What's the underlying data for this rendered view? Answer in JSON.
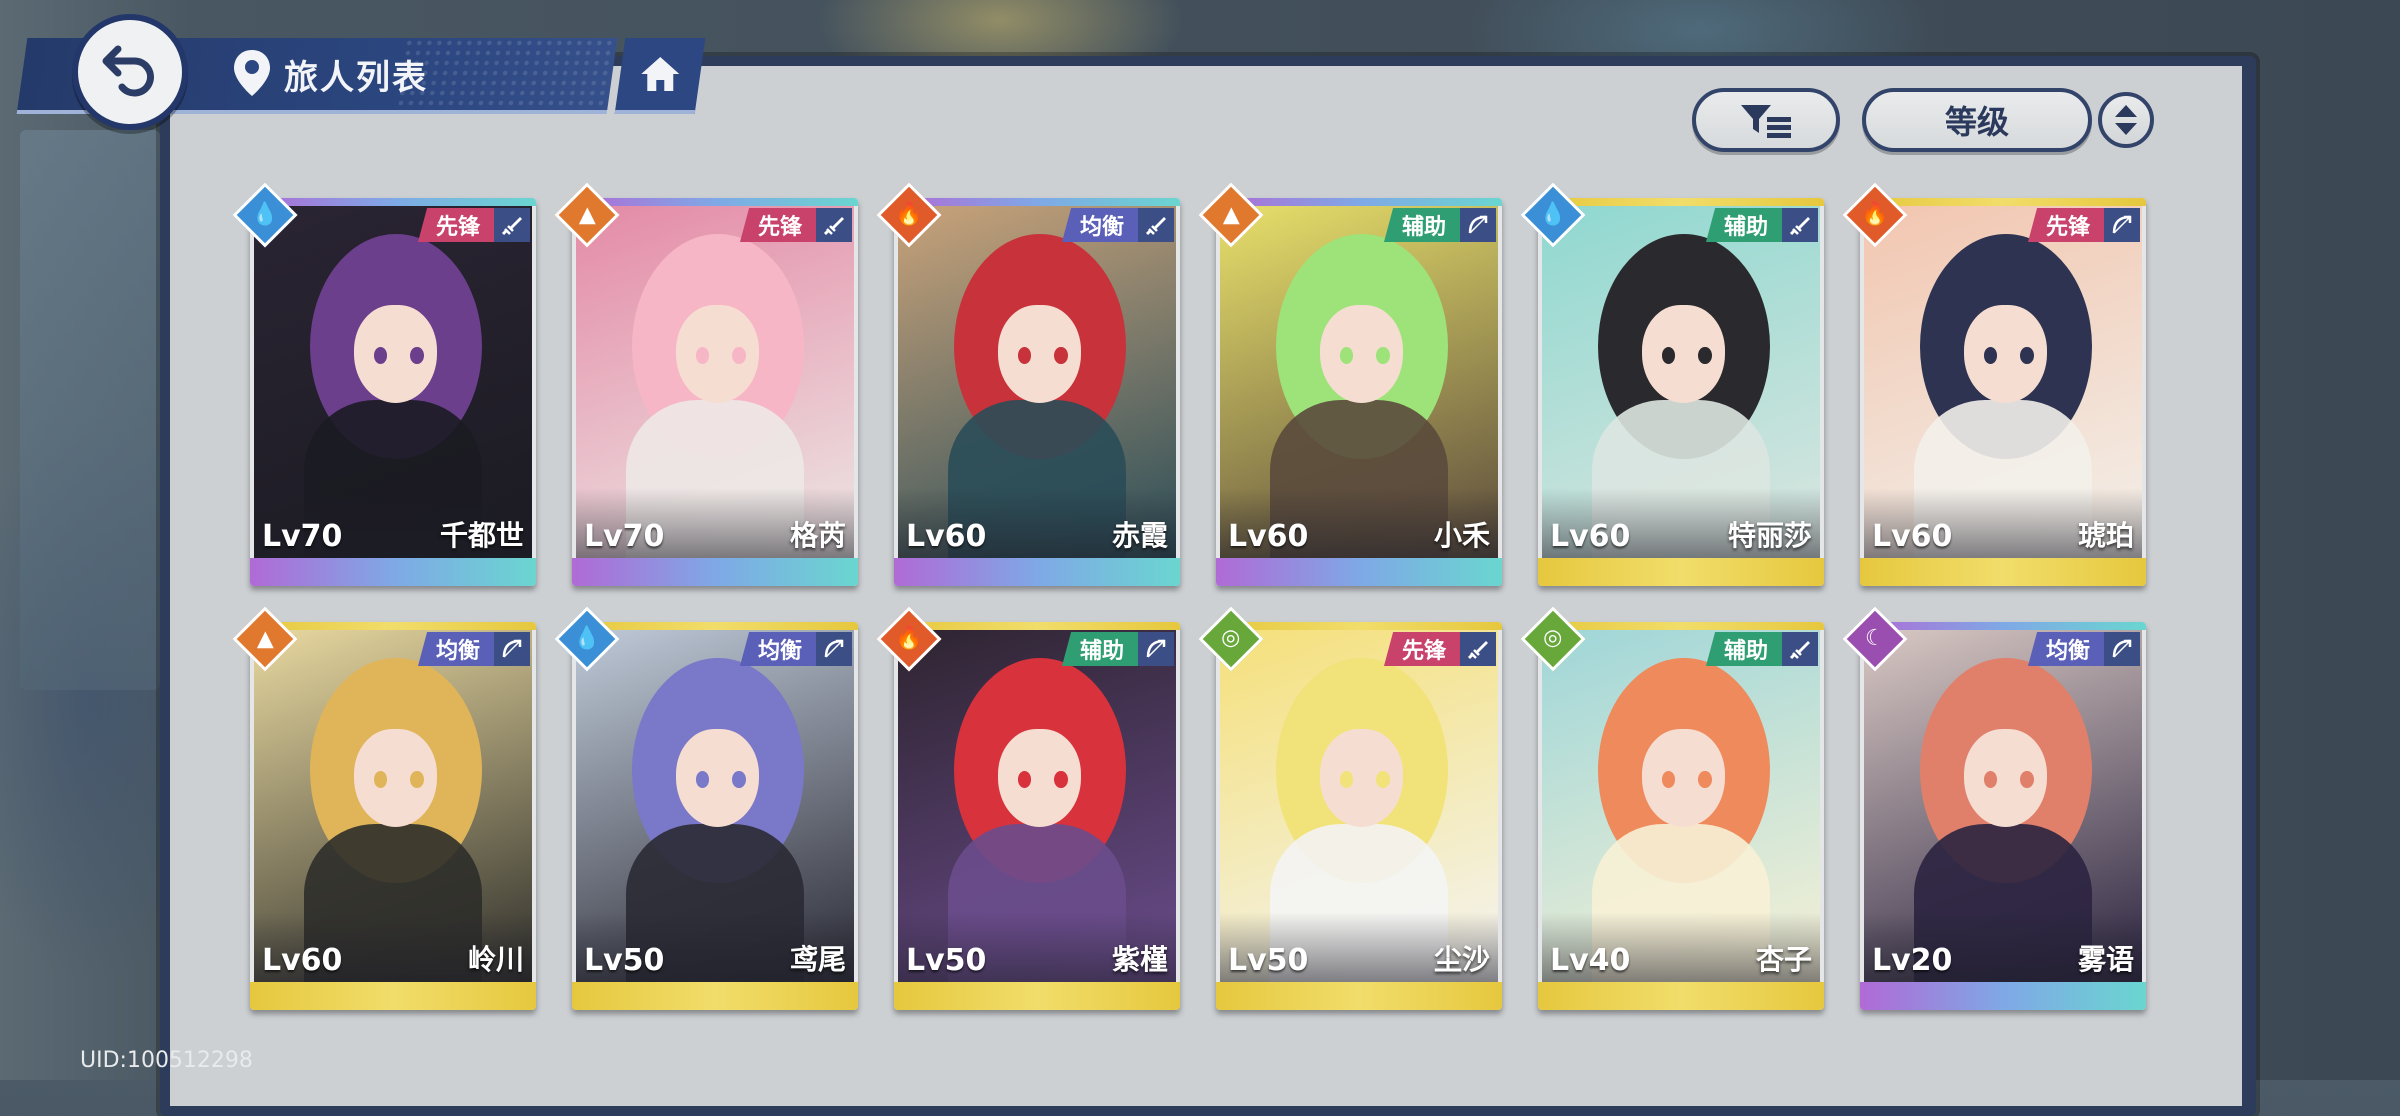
{
  "header": {
    "title": "旅人列表",
    "back_icon": "back-arrow-icon",
    "location_icon": "location-pin-icon",
    "home_icon": "home-icon"
  },
  "toolbar": {
    "filter_icon": "filter-icon",
    "sort_label": "等级",
    "sort_order_icon": "sort-toggle-icon"
  },
  "footer": {
    "uid": "UID:100512298"
  },
  "colors": {
    "role_vanguard": "#c9426c",
    "role_balance": "#5a5fb8",
    "role_support": "#2f9e72",
    "element_water": "#3a8fd6",
    "element_fire": "#e05a2a",
    "element_earth": "#e0782e",
    "element_wind": "#68a83a",
    "element_dark": "#9a4fb0",
    "rarity_ssr": "#c27bd8",
    "rarity_sr": "#e5cc46"
  },
  "characters": [
    {
      "name": "千都世",
      "level": "Lv70",
      "role": "先锋",
      "element": "water",
      "weapon": "sword-icon",
      "rarity": "ssr"
    },
    {
      "name": "格芮",
      "level": "Lv70",
      "role": "先锋",
      "element": "earth",
      "weapon": "sword-icon",
      "rarity": "ssr"
    },
    {
      "name": "赤霞",
      "level": "Lv60",
      "role": "均衡",
      "element": "fire",
      "weapon": "sword-icon",
      "rarity": "ssr"
    },
    {
      "name": "小禾",
      "level": "Lv60",
      "role": "辅助",
      "element": "earth",
      "weapon": "bow-icon",
      "rarity": "ssr"
    },
    {
      "name": "特丽莎",
      "level": "Lv60",
      "role": "辅助",
      "element": "water",
      "weapon": "sword-icon",
      "rarity": "sr"
    },
    {
      "name": "琥珀",
      "level": "Lv60",
      "role": "先锋",
      "element": "fire",
      "weapon": "bow-icon",
      "rarity": "sr"
    },
    {
      "name": "岭川",
      "level": "Lv60",
      "role": "均衡",
      "element": "earth",
      "weapon": "bow-icon",
      "rarity": "sr"
    },
    {
      "name": "鸢尾",
      "level": "Lv50",
      "role": "均衡",
      "element": "water",
      "weapon": "bow-icon",
      "rarity": "sr"
    },
    {
      "name": "紫槿",
      "level": "Lv50",
      "role": "辅助",
      "element": "fire",
      "weapon": "bow-icon",
      "rarity": "sr"
    },
    {
      "name": "尘沙",
      "level": "Lv50",
      "role": "先锋",
      "element": "wind",
      "weapon": "sword-icon",
      "rarity": "sr"
    },
    {
      "name": "杏子",
      "level": "Lv40",
      "role": "辅助",
      "element": "wind",
      "weapon": "sword-icon",
      "rarity": "sr"
    },
    {
      "name": "雾语",
      "level": "Lv20",
      "role": "均衡",
      "element": "dark",
      "weapon": "bow-icon",
      "rarity": "ssr"
    }
  ]
}
